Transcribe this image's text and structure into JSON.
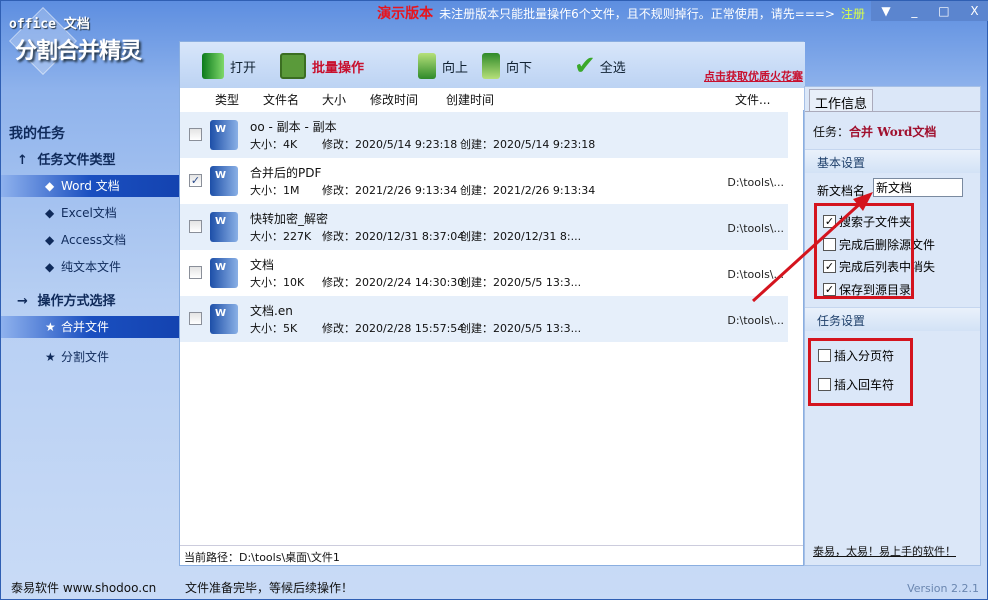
{
  "app": {
    "logo_line1": "office 文档",
    "logo_line2": "分割合并精灵"
  },
  "notice": {
    "demo": "演示版本",
    "text": "未注册版本只能批量操作6个文件，且不规则掉行。正常使用，请先===>",
    "register": "注册"
  },
  "window_controls": {
    "menu": "▼",
    "minimize": "_",
    "maximize": "□",
    "close": "X"
  },
  "sidebar": {
    "title": "我的任务",
    "group1": {
      "label": "任务文件类型",
      "items": [
        {
          "label": "Word 文档",
          "selected": true
        },
        {
          "label": "Excel文档"
        },
        {
          "label": "Access文档"
        },
        {
          "label": "纯文本文件"
        }
      ]
    },
    "group2": {
      "label": "操作方式选择",
      "items": [
        {
          "label": "合并文件",
          "selected": true
        },
        {
          "label": "分割文件"
        }
      ]
    }
  },
  "toolbar": {
    "open": "打开",
    "batch": "批量操作",
    "up": "向上",
    "down": "向下",
    "select_all": "全选",
    "promo": "点击获取优质火花塞"
  },
  "columns": [
    "类型",
    "文件名",
    "大小",
    "修改时间",
    "创建时间",
    "文件..."
  ],
  "files": [
    {
      "name": "oo - 副本 - 副本",
      "size": "大小：4K",
      "modified": "修改：2020/5/14 9:23:18",
      "created": "创建：2020/5/14 9:23:18",
      "path": "",
      "checked": false
    },
    {
      "name": "合并后的PDF",
      "size": "大小：1M",
      "modified": "修改：2021/2/26 9:13:34",
      "created": "创建：2021/2/26 9:13:34",
      "path": "D:\\tools\\...",
      "checked": true
    },
    {
      "name": "快转加密_解密",
      "size": "大小：227K",
      "modified": "修改：2020/12/31 8:37:04",
      "created": "创建：2020/12/31 8:...",
      "path": "D:\\tools\\...",
      "checked": false
    },
    {
      "name": "文档",
      "size": "大小：10K",
      "modified": "修改：2020/2/24 14:30:30",
      "created": "创建：2020/5/5 13:3...",
      "path": "D:\\tools\\...",
      "checked": false
    },
    {
      "name": "文档.en",
      "size": "大小：5K",
      "modified": "修改：2020/2/28 15:57:54",
      "created": "创建：2020/5/5 13:3...",
      "path": "D:\\tools\\...",
      "checked": false
    }
  ],
  "current_path": "当前路径：D:\\tools\\桌面\\文件1",
  "panel": {
    "tab": "工作信息",
    "task_label": "任务：",
    "task_value": "合并 Word文档",
    "basic": "基本设置",
    "newname_label": "新文档名",
    "newname_value": "新文档",
    "options": [
      {
        "label": "搜索子文件夹",
        "checked": true
      },
      {
        "label": "完成后删除源文件",
        "checked": false
      },
      {
        "label": "完成后列表中消失",
        "checked": true
      },
      {
        "label": "保存到源目录",
        "checked": true
      }
    ],
    "task_settings": "任务设置",
    "task_options": [
      {
        "label": "插入分页符",
        "checked": false
      },
      {
        "label": "插入回车符",
        "checked": false
      }
    ],
    "slogan": "泰易，太易！易上手的软件！"
  },
  "status": {
    "company": "泰易软件 www.shodoo.cn",
    "message": "文件准备完毕，等候后续操作！",
    "version": "Version 2.2.1"
  },
  "colors": {
    "accent": "#1443b0",
    "highlight": "#d4141e"
  }
}
